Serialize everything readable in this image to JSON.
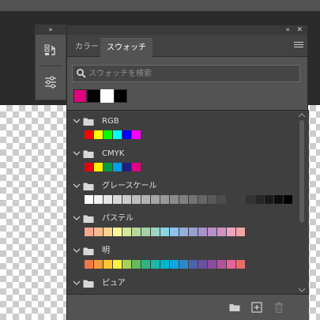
{
  "panel": {
    "tabs": [
      {
        "label": "カラー",
        "active": false
      },
      {
        "label": "スウォッチ",
        "active": true
      }
    ],
    "header_icons": {
      "collapse": "»",
      "expand": "«",
      "close": "✕"
    },
    "search": {
      "placeholder": "スウォッチを検索",
      "value": ""
    },
    "recent_swatches": [
      "#e4007f",
      "#000000",
      "#ffffff",
      "#000000"
    ],
    "selected_recent_index": 2,
    "groups": [
      {
        "name": "RGB",
        "swatches": [
          "#ff0000",
          "#ffff00",
          "#00ff00",
          "#00ffff",
          "#0000ff",
          "#ff00ff"
        ]
      },
      {
        "name": "CMYK",
        "swatches": [
          "#e60012",
          "#fff100",
          "#009944",
          "#00a0e9",
          "#1d2088",
          "#e4007f"
        ]
      },
      {
        "name": "グレースケール",
        "swatches": [
          "#ffffff",
          "#f2f2f2",
          "#e6e6e6",
          "#d9d9d9",
          "#cccccc",
          "#bfbfbf",
          "#b3b3b3",
          "#a6a6a6",
          "#999999",
          "#8c8c8c",
          "#808080",
          "#737373",
          "#666666",
          "#595959",
          "#4d4d4d",
          "#404040",
          "#333333",
          "#262626",
          "#1a1a1a",
          "#0d0d0d",
          "#000000"
        ]
      },
      {
        "name": "パステル",
        "swatches": [
          "#f5a88e",
          "#f8bb8e",
          "#fdd28c",
          "#fff899",
          "#d7e79c",
          "#b4d99c",
          "#a3d5a5",
          "#9cd5c4",
          "#8fd4e4",
          "#8cc4ee",
          "#95aedc",
          "#9a9fd1",
          "#a793c8",
          "#b98fc4",
          "#cf93c2",
          "#f1a4c0",
          "#f4a4a1"
        ]
      },
      {
        "name": "明",
        "swatches": [
          "#ee7848",
          "#f39c3b",
          "#fbc533",
          "#fff23f",
          "#a9d15c",
          "#62bb5c",
          "#2db585",
          "#1ab8a8",
          "#00b7ce",
          "#0ea7e3",
          "#2e87c8",
          "#4c62ab",
          "#6b50a0",
          "#8b4c9d",
          "#b0559a",
          "#e7639a",
          "#ea6a6d"
        ]
      },
      {
        "name": "ピュア",
        "swatches": []
      }
    ],
    "bottom_actions": [
      {
        "name": "new-group",
        "icon": "folder-icon"
      },
      {
        "name": "new-swatch",
        "icon": "add-icon"
      },
      {
        "name": "delete",
        "icon": "trash-icon"
      }
    ]
  },
  "colors": {
    "panel_bg": "#535353",
    "list_bg": "#3f3f3f",
    "header_bg": "#3a3a3a",
    "text": "#d6d6d6"
  }
}
